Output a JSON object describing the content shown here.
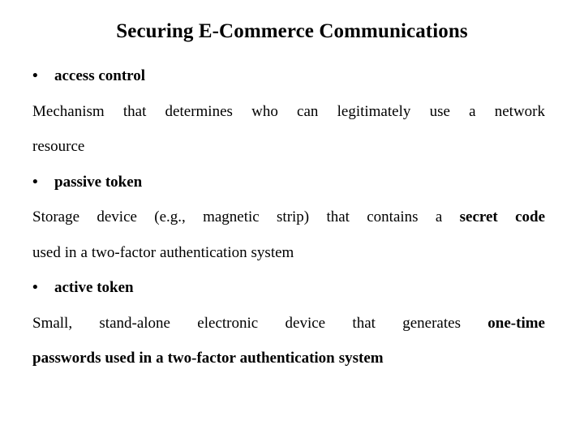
{
  "slide": {
    "title": "Securing E-Commerce Communications",
    "bullet_glyph": "•",
    "text_color": "#000000",
    "background_color": "#ffffff",
    "items": [
      {
        "term": "access control",
        "definition_line1": "Mechanism that determines who can legitimately use a network",
        "definition_line2": "resource",
        "bold_runs": []
      },
      {
        "term": "passive token",
        "definition_line1_plain": "Storage device (e.g., magnetic strip) that contains a ",
        "definition_line1_bold": "secret code",
        "definition_line2": "used in a two-factor authentication system",
        "bold_runs": [
          "secret code"
        ]
      },
      {
        "term": "active token",
        "definition_line1_plain": "Small, stand-alone electronic device that generates ",
        "definition_line1_bold": "one-time",
        "definition_line2": "passwords used in a two-factor authentication system",
        "bold_runs": [
          "one-time",
          "passwords used in a two-factor authentication system"
        ]
      }
    ]
  }
}
